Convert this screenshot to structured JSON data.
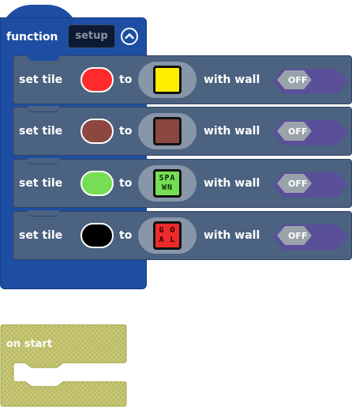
{
  "function_block": {
    "keyword": "function",
    "name": "setup"
  },
  "rows": [
    {
      "set_label": "set tile",
      "to_label": "to",
      "with_wall_label": "with wall",
      "color": "#ff2a2a",
      "tile": {
        "fill": "#ffee00",
        "line1": "",
        "line2": "",
        "text_color": "#000000"
      },
      "toggle": "OFF"
    },
    {
      "set_label": "set tile",
      "to_label": "to",
      "with_wall_label": "with wall",
      "color": "#8b4740",
      "tile": {
        "fill": "#8b4740",
        "line1": "",
        "line2": "",
        "text_color": "#000000"
      },
      "toggle": "OFF"
    },
    {
      "set_label": "set tile",
      "to_label": "to",
      "with_wall_label": "with wall",
      "color": "#77dd55",
      "tile": {
        "fill": "#77dd55",
        "line1": "SPA",
        "line2": "WN",
        "text_color": "#0a2a0a"
      },
      "toggle": "OFF"
    },
    {
      "set_label": "set tile",
      "to_label": "to",
      "with_wall_label": "with wall",
      "color": "#000000",
      "tile": {
        "fill": "#ee2b2b",
        "line1": "G O",
        "line2": "A L",
        "text_color": "#220000"
      },
      "toggle": "OFF"
    }
  ],
  "on_start": {
    "label": "on start"
  },
  "colors": {
    "function_blue": "#1e4ea3",
    "row_slate": "#4b6280",
    "toggle_purple": "#5a4f99",
    "toggle_gray": "#9aa3ab",
    "onstart_olive": "#c9c977"
  }
}
